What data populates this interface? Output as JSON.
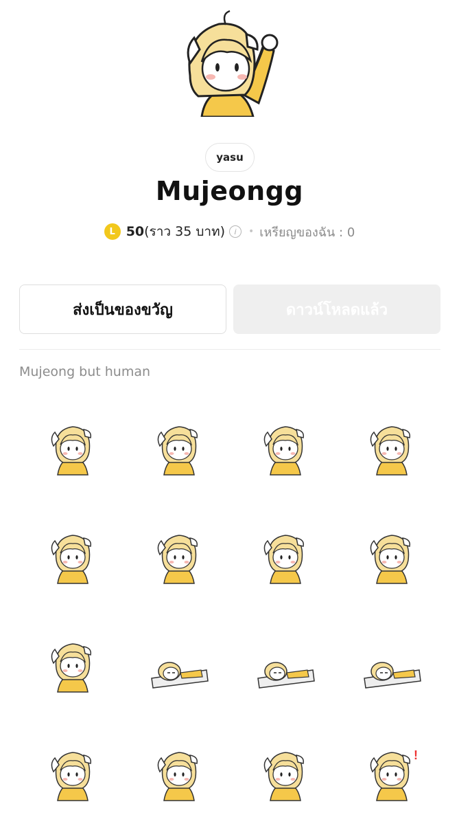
{
  "package": {
    "author": "yasu",
    "title": "Mujeongg",
    "description": "Mujeong but human"
  },
  "price": {
    "coin_symbol": "L",
    "amount": "50",
    "approx": "(ราว 35 บาท)",
    "balance_label": "เหรียญของฉัน : 0"
  },
  "actions": {
    "gift_label": "ส่งเป็นของขวัญ",
    "downloaded_label": "ดาวน์โหลดแล้ว"
  },
  "colors": {
    "accent_yellow": "#f2c81c",
    "hair": "#f6df9a",
    "hoodie": "#f5c84a"
  },
  "stickers": [
    {
      "icon": "sticker-holding-phone-icon"
    },
    {
      "icon": "sticker-selfie-icon"
    },
    {
      "icon": "sticker-waving-icon"
    },
    {
      "icon": "sticker-surprised-icon"
    },
    {
      "icon": "sticker-sighing-icon"
    },
    {
      "icon": "sticker-blushing-icon"
    },
    {
      "icon": "sticker-holding-gift-icon"
    },
    {
      "icon": "sticker-holding-sign-icon"
    },
    {
      "icon": "sticker-back-turned-icon"
    },
    {
      "icon": "sticker-lying-on-bed-icon"
    },
    {
      "icon": "sticker-in-bed-icon"
    },
    {
      "icon": "sticker-lying-flat-icon"
    },
    {
      "icon": "sticker-crying-icon"
    },
    {
      "icon": "sticker-box-icon"
    },
    {
      "icon": "sticker-thumbs-up-icon"
    },
    {
      "icon": "sticker-exclamation-icon"
    }
  ]
}
